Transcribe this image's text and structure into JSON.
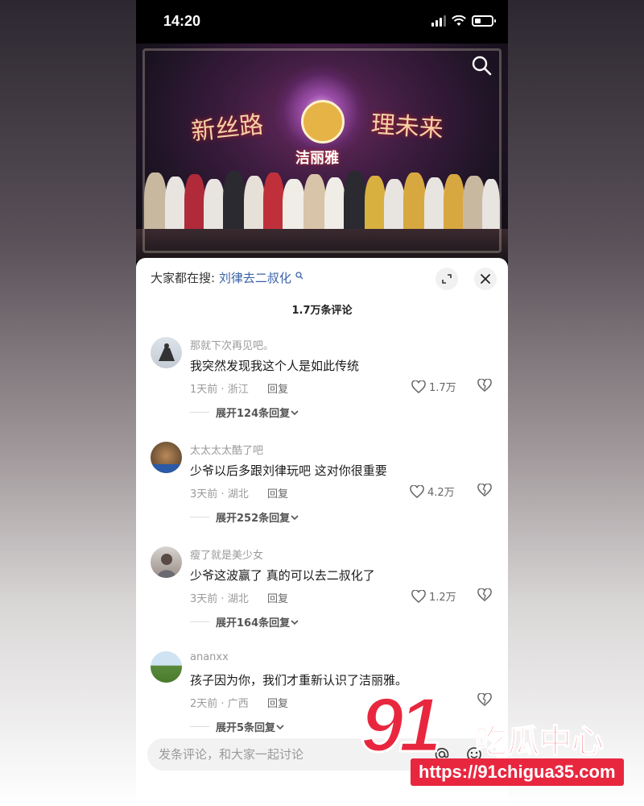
{
  "status_bar": {
    "time": "14:20"
  },
  "video": {
    "stage_text_left": "新丝路",
    "stage_text_right": "理未来",
    "brand_text": "洁丽雅"
  },
  "comments_sheet": {
    "search_prefix": "大家都在搜:",
    "search_term": "刘律去二叔化",
    "count_label": "1.7万条评论",
    "comments": [
      {
        "user": "那就下次再见吧。",
        "text": "我突然发现我这个人是如此传统",
        "time": "1天前",
        "location": "浙江",
        "reply_label": "回复",
        "likes": "1.7万",
        "expand_label": "展开124条回复"
      },
      {
        "user": "太太太太酷了吧",
        "text": "少爷以后多跟刘律玩吧 这对你很重要",
        "time": "3天前",
        "location": "湖北",
        "reply_label": "回复",
        "likes": "4.2万",
        "expand_label": "展开252条回复"
      },
      {
        "user": "瘦了就是美少女",
        "text": "少爷这波赢了 真的可以去二叔化了",
        "time": "3天前",
        "location": "湖北",
        "reply_label": "回复",
        "likes": "1.2万",
        "expand_label": "展开164条回复"
      },
      {
        "user": "ananxx",
        "text": "孩子因为你，我们才重新认识了洁丽雅。",
        "time": "2天前",
        "location": "广西",
        "reply_label": "回复",
        "likes": "",
        "expand_label": "展开5条回复"
      }
    ],
    "input_placeholder": "发条评论，和大家一起讨论"
  },
  "watermark": {
    "number": "91",
    "name": "吃瓜中心",
    "url": "https://91chigua35.com"
  },
  "colors": {
    "accent_link": "#3a62a8",
    "watermark_red": "#e8273f"
  }
}
